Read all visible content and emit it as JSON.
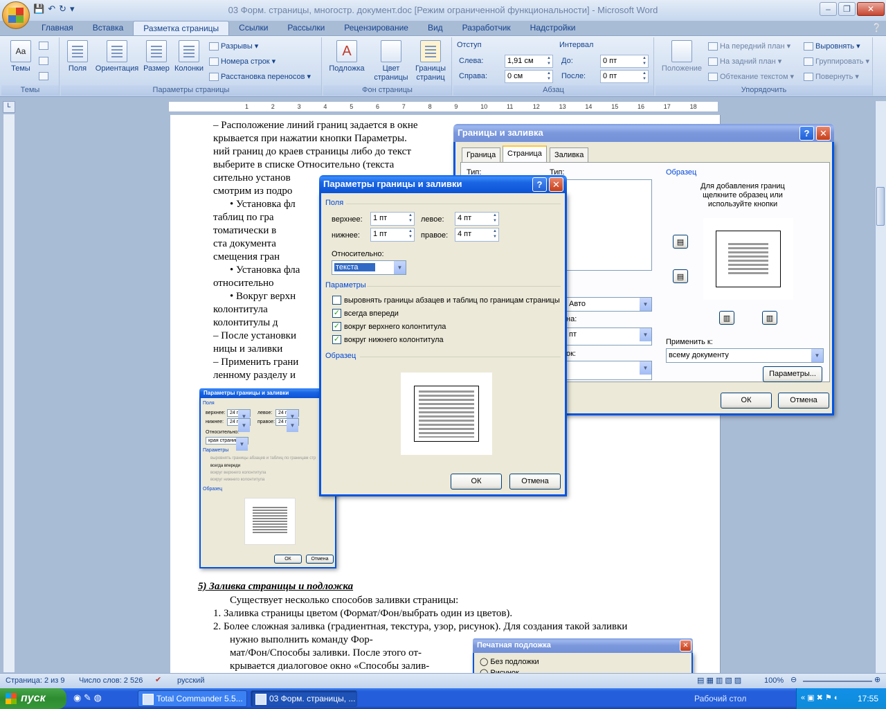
{
  "window": {
    "title": "03 Форм. страницы, многостр. документ.doc [Режим ограниченной функциональности] - Microsoft Word"
  },
  "tabs": [
    "Главная",
    "Вставка",
    "Разметка страницы",
    "Ссылки",
    "Рассылки",
    "Рецензирование",
    "Вид",
    "Разработчик",
    "Надстройки"
  ],
  "active_tab": "Разметка страницы",
  "ribbon": {
    "themes": {
      "themes_label": "Темы",
      "group": "Темы"
    },
    "page_setup": {
      "margins": "Поля",
      "orientation": "Ориентация",
      "size": "Размер",
      "columns": "Колонки",
      "breaks": "Разрывы",
      "line_numbers": "Номера строк",
      "hyphenation": "Расстановка переносов",
      "group": "Параметры страницы"
    },
    "page_bg": {
      "watermark": "Подложка",
      "color1": "Цвет",
      "color2": "страницы",
      "borders1": "Границы",
      "borders2": "страниц",
      "group": "Фон страницы"
    },
    "paragraph": {
      "indent": "Отступ",
      "left": "Слева:",
      "left_val": "1,91 см",
      "right": "Справа:",
      "right_val": "0 см",
      "spacing": "Интервал",
      "before": "До:",
      "before_val": "0 пт",
      "after": "После:",
      "after_val": "0 пт",
      "group": "Абзац"
    },
    "arrange": {
      "position": "Положение",
      "front": "На передний план",
      "back": "На задний план",
      "wrap": "Обтекание текстом",
      "align": "Выровнять",
      "group_btn": "Группировать",
      "rotate": "Повернуть",
      "group": "Упорядочить"
    }
  },
  "ruler": {
    "marks": [
      "1",
      "2",
      "3",
      "4",
      "5",
      "6",
      "7",
      "8",
      "9",
      "10",
      "11",
      "12",
      "13",
      "14",
      "15",
      "16",
      "17",
      "18"
    ]
  },
  "document": {
    "lines": [
      "–   Расположение линий границ задается в окне",
      "     крывается при нажатии кнопки Параметры.",
      "     ний границ до краев страницы либо до текст",
      "     выберите в списке Относительно (текста",
      "     сительно установ",
      "     смотрим из подро",
      "•   Установка фл",
      "     таблиц по гра",
      "     томатически в",
      "     ста документа",
      "     смещения гран",
      "•   Установка фла",
      "     относительно",
      "•   Вокруг верхн",
      "     колонтитула",
      "     колонтитулы д",
      "–   После установки",
      "     ницы и заливки",
      "–   Применить грани",
      "     ленному разделу и"
    ],
    "section5_title": "5)   Заливка страницы и подложка",
    "section5_lines": [
      "Существует несколько способов заливки страницы:",
      "1.   Заливка страницы цветом (Формат/Фон/выбрать один из цветов).",
      "2.   Более сложная заливка (градиентная, текстура, узор, рисунок). Для создания такой заливки",
      "нужно       выполнить       команду       Фор-",
      "мат/Фон/Способы заливки. После этого от-",
      "крывается диалоговое окно «Способы залив-"
    ]
  },
  "dialog_main": {
    "title": "Границы и заливка",
    "tabs": [
      "Граница",
      "Страница",
      "Заливка"
    ],
    "active_tab": "Страница",
    "type_label": "Тип:",
    "type2_label": "Тип:",
    "preview_label": "Образец",
    "preview_hint": "Для добавления границ щелкните образец или используйте кнопки",
    "color_value": "Авто",
    "width_label": "на:",
    "width_value": "пт",
    "art_label": "ок:",
    "apply_label": "Применить к:",
    "apply_value": "всему документу",
    "options_btn": "Параметры...",
    "ok": "ОК",
    "cancel": "Отмена"
  },
  "dialog_params": {
    "title": "Параметры границы и заливки",
    "fields_section": "Поля",
    "top_label": "верхнее:",
    "top_val": "1 пт",
    "left_label": "левое:",
    "left_val": "4 пт",
    "bottom_label": "нижнее:",
    "bottom_val": "1 пт",
    "right_label": "правое:",
    "right_val": "4 пт",
    "relative_label": "Относительно:",
    "relative_val": "текста",
    "params_section": "Параметры",
    "opt1": "выровнять границы абзацев и таблиц по границам страницы",
    "opt2": "всегда впереди",
    "opt3": "вокруг верхнего колонтитула",
    "opt4": "вокруг нижнего колонтитула",
    "opt1_checked": false,
    "opt2_checked": true,
    "opt3_checked": true,
    "opt4_checked": true,
    "sample_section": "Образец",
    "ok": "ОК",
    "cancel": "Отмена"
  },
  "dialog_small": {
    "title": "Параметры границы и заливки",
    "fields_section": "Поля",
    "top_label": "верхнее:",
    "top_val": "24 пт",
    "left_label": "левое:",
    "left_val": "24 пт",
    "bottom_label": "нижнее:",
    "bottom_val": "24 пт",
    "right_label": "правое:",
    "right_val": "24 пт",
    "relative_label": "Относительно:",
    "relative_val": "края страницы",
    "params_section": "Параметры",
    "opt1": "выровнять границы абзацев и таблиц по границам стр",
    "opt2": "всегда впереди",
    "opt3": "вокруг верхнего колонтитула",
    "opt4": "вокруг нижнего колонтитула",
    "sample_section": "Образец",
    "ok": "ОК",
    "cancel": "Отмена"
  },
  "dialog_watermark": {
    "title": "Печатная подложка",
    "opt_none": "Без подложки",
    "opt_pic": "Рисунок"
  },
  "statusbar": {
    "page": "Страница: 2 из 9",
    "words": "Число слов: 2 526",
    "lang": "русский",
    "zoom": "100%"
  },
  "taskbar": {
    "start": "пуск",
    "items": [
      "Total Commander 5.5...",
      "03 Форм. страницы, ..."
    ],
    "desktop": "Рабочий стол",
    "clock": "17:55"
  },
  "colors": {
    "accent": "#15428b",
    "xp_title": "#0054e3",
    "dialog_bg": "#ece9d8"
  }
}
